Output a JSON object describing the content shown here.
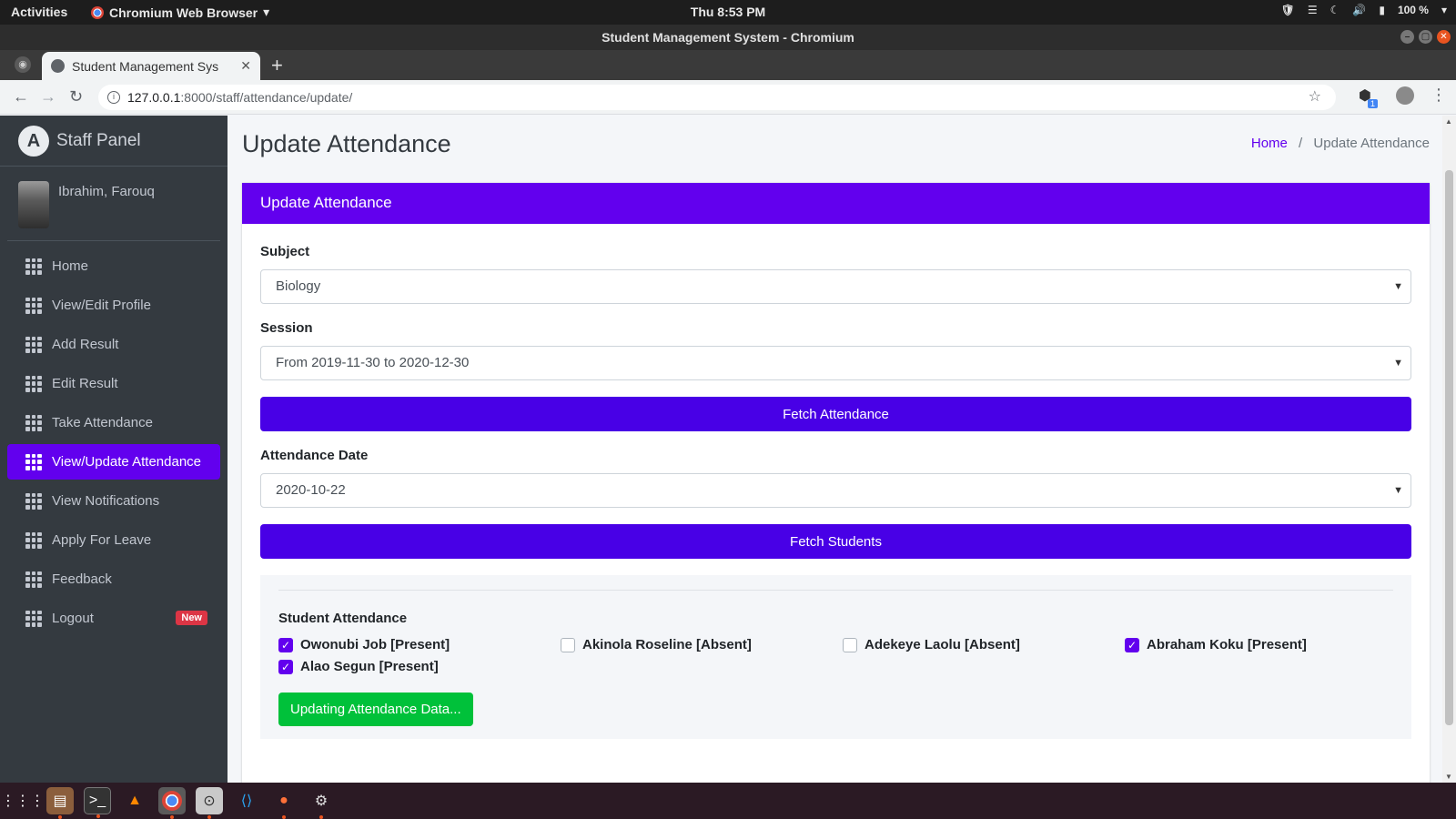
{
  "gnome": {
    "activities": "Activities",
    "app_menu": "Chromium Web Browser",
    "clock": "Thu  8:53 PM",
    "battery": "100 %"
  },
  "window": {
    "title": "Student Management System - Chromium"
  },
  "browser": {
    "tab_title": "Student Management Sys",
    "url_host": "127.0.0.1",
    "url_rest": ":8000/staff/attendance/update/",
    "ext_badge": "1"
  },
  "sidebar": {
    "brand": "Staff Panel",
    "user_name": "Ibrahim, Farouq",
    "items": [
      {
        "label": "Home",
        "active": false
      },
      {
        "label": "View/Edit Profile",
        "active": false
      },
      {
        "label": "Add Result",
        "active": false
      },
      {
        "label": "Edit Result",
        "active": false
      },
      {
        "label": "Take Attendance",
        "active": false
      },
      {
        "label": "View/Update Attendance",
        "active": true
      },
      {
        "label": "View Notifications",
        "active": false
      },
      {
        "label": "Apply For Leave",
        "active": false
      },
      {
        "label": "Feedback",
        "active": false
      },
      {
        "label": "Logout",
        "active": false,
        "badge": "New"
      }
    ]
  },
  "page": {
    "title": "Update Attendance",
    "breadcrumb_home": "Home",
    "breadcrumb_current": "Update Attendance"
  },
  "card": {
    "header": "Update Attendance",
    "subject_label": "Subject",
    "subject_value": "Biology",
    "session_label": "Session",
    "session_value": "From 2019-11-30 to 2020-12-30",
    "fetch_attendance": "Fetch Attendance",
    "date_label": "Attendance Date",
    "date_value": "2020-10-22",
    "fetch_students": "Fetch Students",
    "attendance_title": "Student Attendance",
    "students": [
      {
        "label": "Owonubi Job [Present]",
        "checked": true
      },
      {
        "label": "Akinola Roseline [Absent]",
        "checked": false
      },
      {
        "label": "Adekeye Laolu [Absent]",
        "checked": false
      },
      {
        "label": "Abraham Koku [Present]",
        "checked": true
      },
      {
        "label": "Alao Segun [Present]",
        "checked": true
      }
    ],
    "update_button": "Updating Attendance Data..."
  },
  "colors": {
    "primary": "#6200ee",
    "sidebar_bg": "#343a40",
    "success": "#00c13a",
    "badge_danger": "#dc3545"
  },
  "dock_icons": [
    "app-grid-icon",
    "files-icon",
    "terminal-icon",
    "vlc-icon",
    "chromium-icon",
    "password-manager-icon",
    "vscode-icon",
    "firefox-icon",
    "settings-icon"
  ]
}
